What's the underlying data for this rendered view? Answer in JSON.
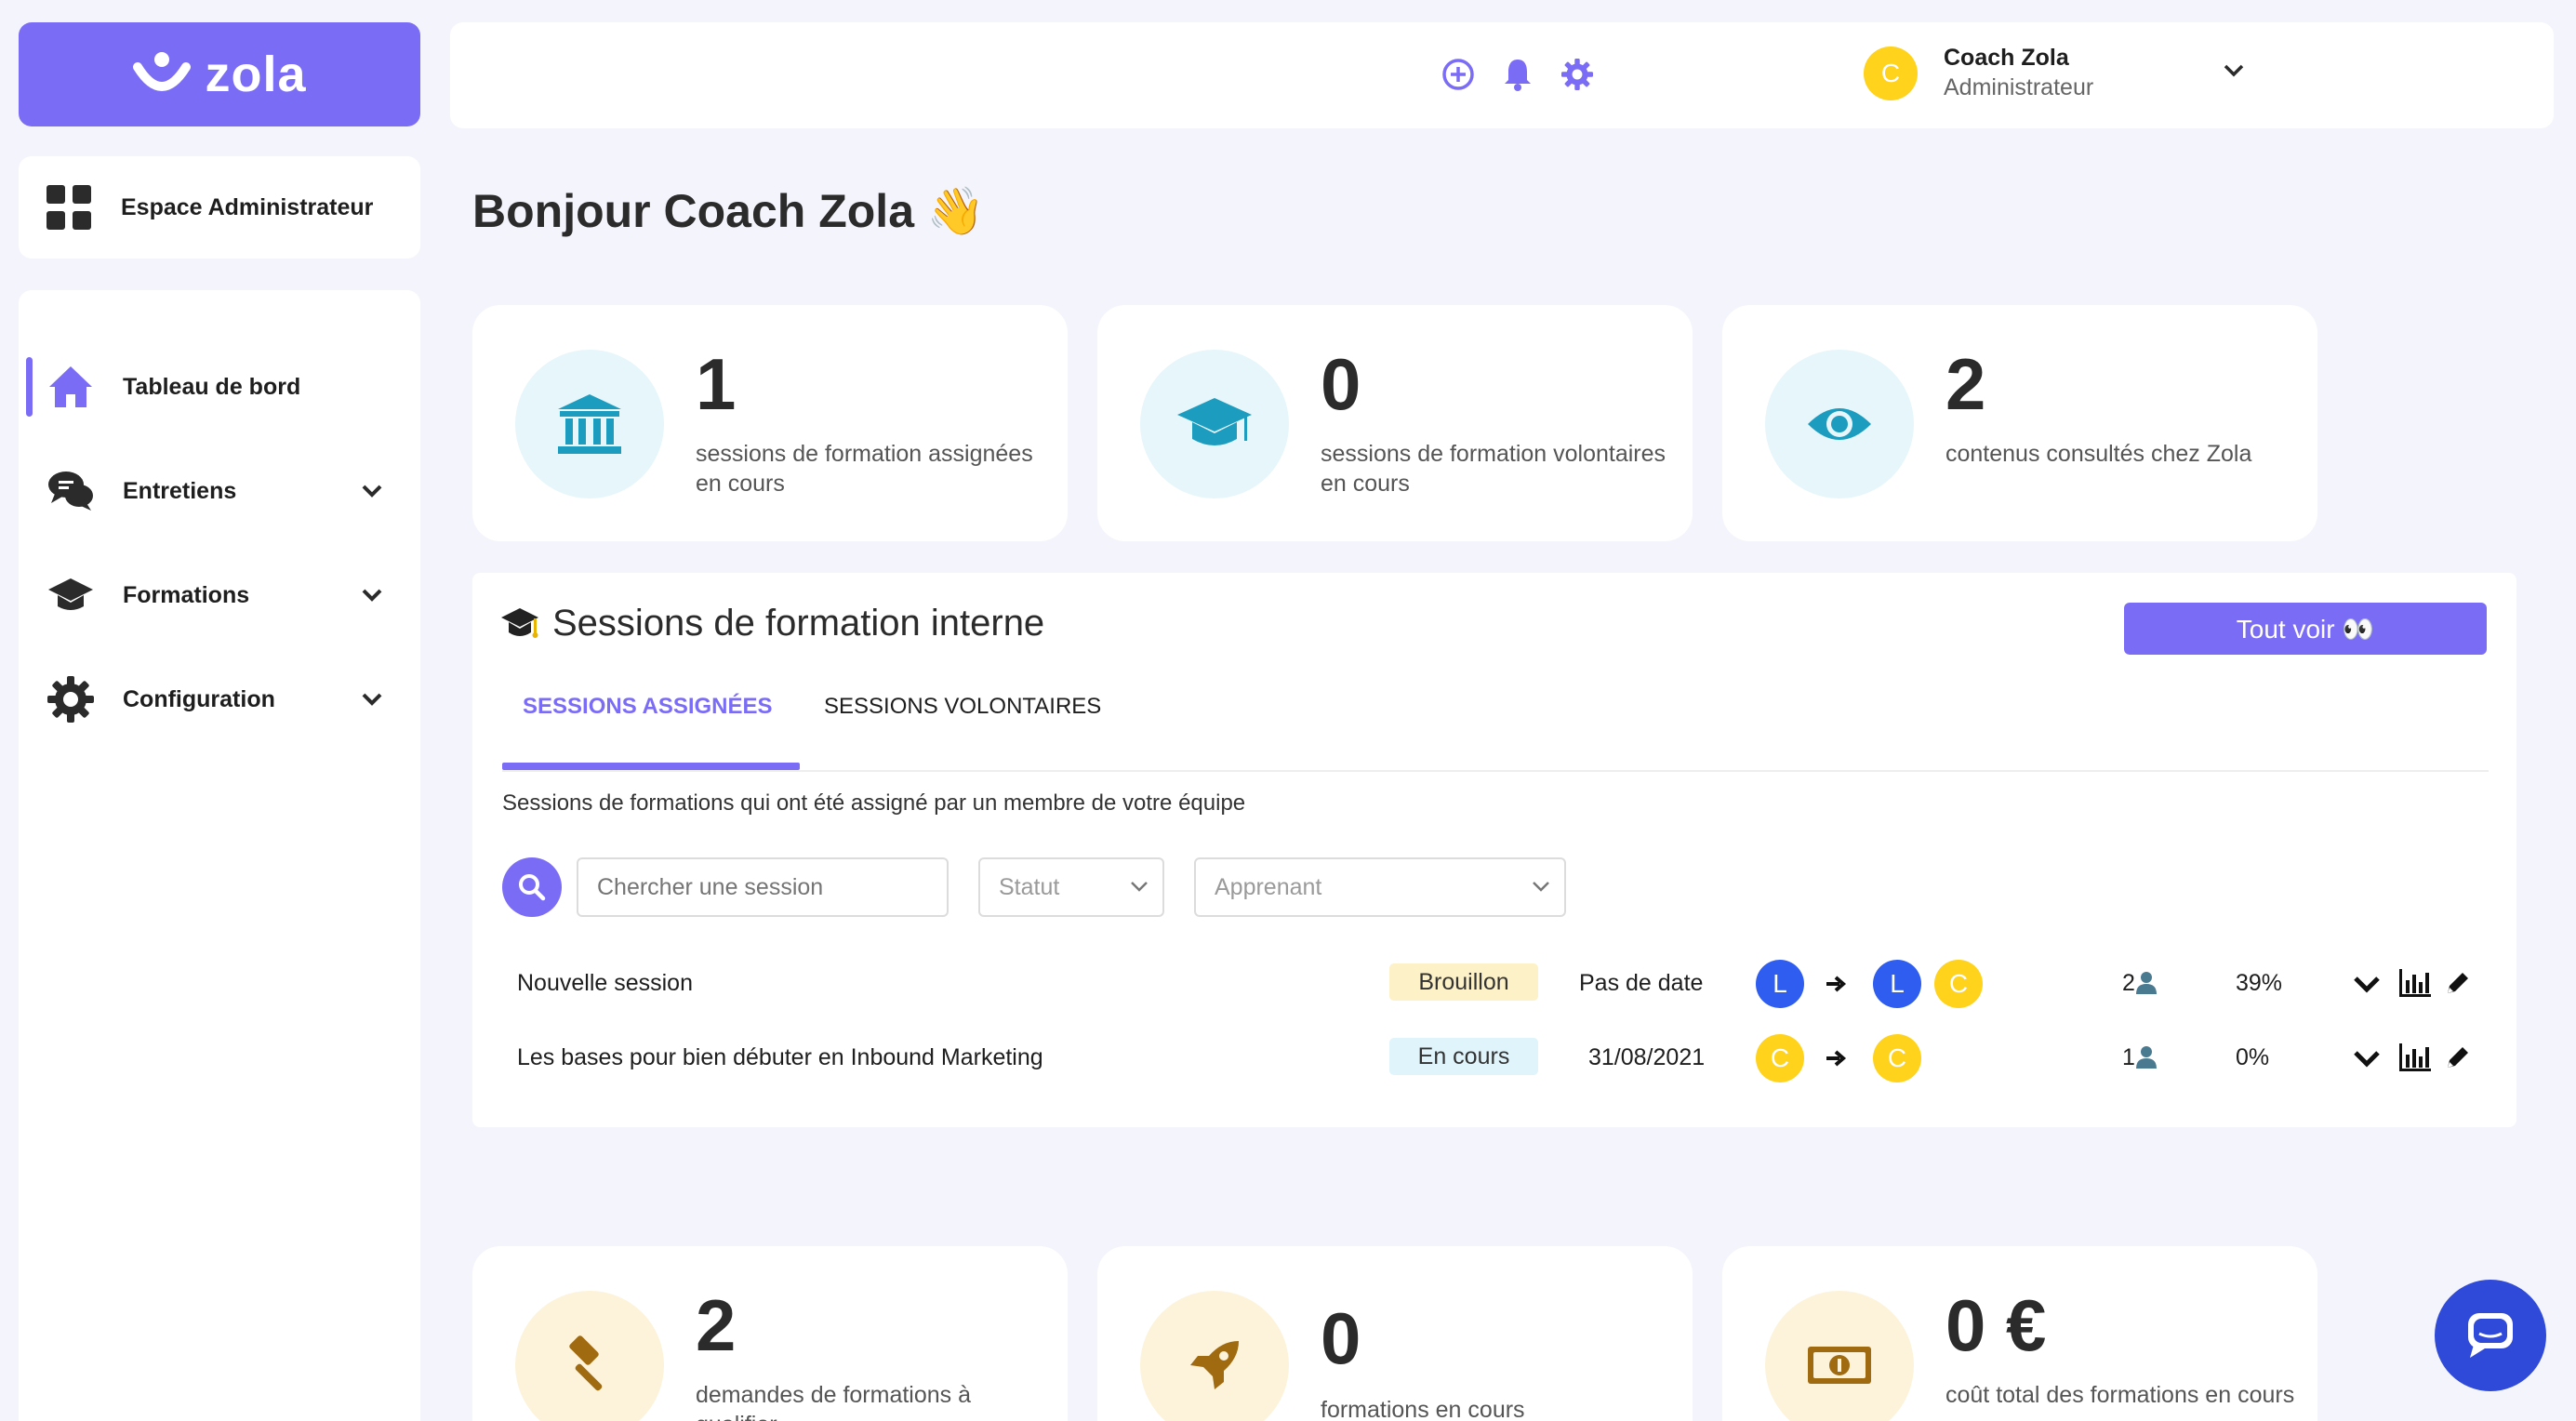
{
  "brand": {
    "name": "zola"
  },
  "sidebar": {
    "space_label": "Espace Administrateur",
    "items": [
      {
        "label": "Tableau de bord",
        "icon": "home-icon",
        "active": true
      },
      {
        "label": "Entretiens",
        "icon": "chat-bubbles-icon"
      },
      {
        "label": "Formations",
        "icon": "graduation-cap-icon"
      },
      {
        "label": "Configuration",
        "icon": "gear-icon"
      }
    ]
  },
  "topbar": {
    "user_initial": "C",
    "user_name": "Coach Zola",
    "user_role": "Administrateur"
  },
  "greeting": "Bonjour Coach Zola 👋",
  "stats_top": [
    {
      "value": "1",
      "label": "sessions de formation assignées en cours",
      "icon": "bank-icon"
    },
    {
      "value": "0",
      "label": "sessions de formation volontaires en cours",
      "icon": "graduation-cap-icon"
    },
    {
      "value": "2",
      "label": "contenus consultés chez Zola",
      "icon": "eye-icon"
    }
  ],
  "sessions": {
    "title": "Sessions de formation interne",
    "see_all_label": "Tout voir 👀",
    "tabs": [
      {
        "label": "SESSIONS ASSIGNÉES",
        "active": true
      },
      {
        "label": "SESSIONS VOLONTAIRES",
        "active": false
      }
    ],
    "description": "Sessions de formations qui ont été assigné par un membre de votre équipe",
    "search_placeholder": "Chercher une session",
    "status_placeholder": "Statut",
    "learner_placeholder": "Apprenant",
    "rows": [
      {
        "name": "Nouvelle session",
        "status": "Brouillon",
        "date": "Pas de date",
        "from_initial": "L",
        "to_initials": [
          "L",
          "C"
        ],
        "participants": "2",
        "progress": "39%"
      },
      {
        "name": "Les bases pour bien débuter en Inbound Marketing",
        "status": "En cours",
        "date": "31/08/2021",
        "from_initial": "C",
        "to_initials": [
          "C"
        ],
        "participants": "1",
        "progress": "0%"
      }
    ]
  },
  "stats_bottom": [
    {
      "value": "2",
      "label": "demandes de formations à qualifier",
      "icon": "gavel-icon"
    },
    {
      "value": "0",
      "label": "formations en cours",
      "icon": "rocket-icon"
    },
    {
      "value": "0 €",
      "label": "coût total des formations en cours",
      "icon": "banknote-icon"
    }
  ],
  "colors": {
    "accent": "#7b6cf6",
    "avatar_yellow": "#ffd21c",
    "avatar_blue": "#2f5df0",
    "chat": "#2f49d8"
  }
}
